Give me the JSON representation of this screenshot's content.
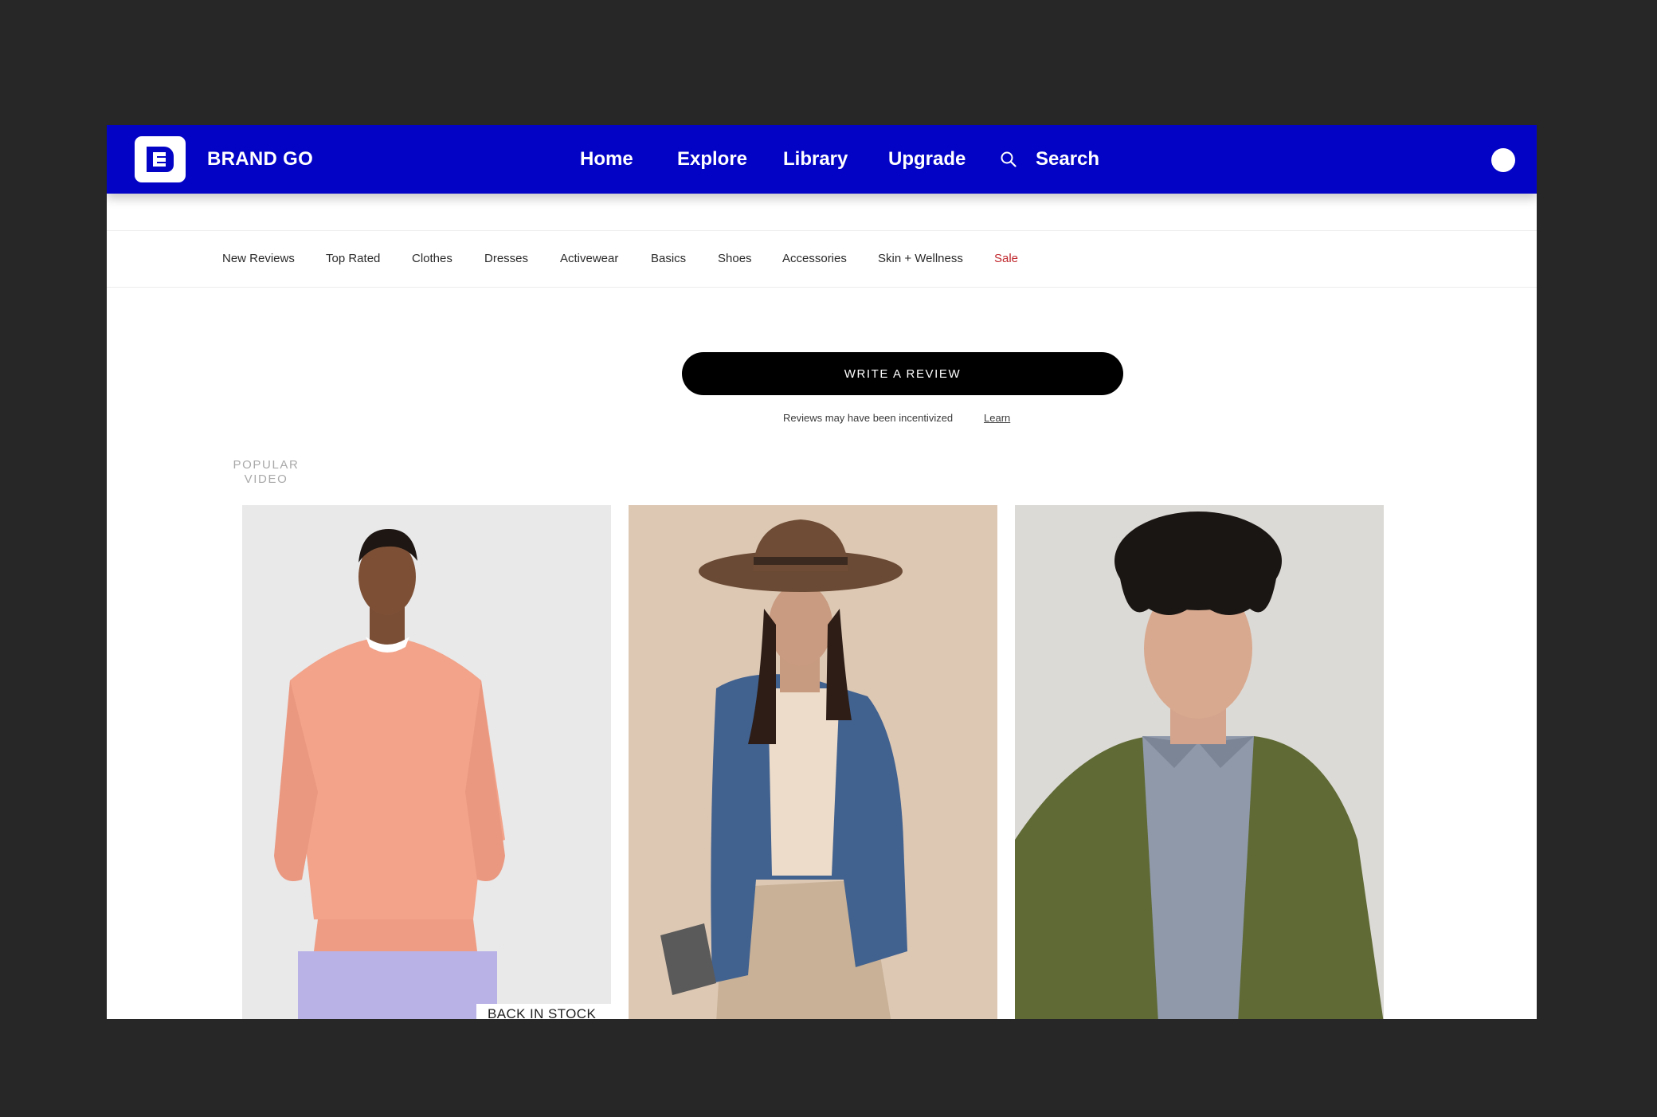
{
  "brand": {
    "name": "BRAND GO",
    "accent": "#0303c6"
  },
  "nav": {
    "home": "Home",
    "explore": "Explore",
    "library": "Library",
    "upgrade": "Upgrade",
    "search": "Search"
  },
  "categories": {
    "new_reviews": "New Reviews",
    "top_rated": "Top Rated",
    "clothes": "Clothes",
    "dresses": "Dresses",
    "activewear": "Activewear",
    "basics": "Basics",
    "shoes": "Shoes",
    "accessories": "Accessories",
    "skin_wellness": "Skin + Wellness",
    "sale": "Sale",
    "sale_color": "#c0272d"
  },
  "review": {
    "button_label": "WRITE A REVIEW",
    "note": "Reviews may have been incentivized",
    "learn_link": "Learn"
  },
  "section": {
    "popular_line1": "POPULAR",
    "popular_line2": "VIDEO"
  },
  "cards": [
    {
      "badge": "BACK IN STOCK"
    }
  ],
  "icons": {
    "logo": "brand-logo-icon",
    "search": "search-icon",
    "avatar": "avatar"
  }
}
